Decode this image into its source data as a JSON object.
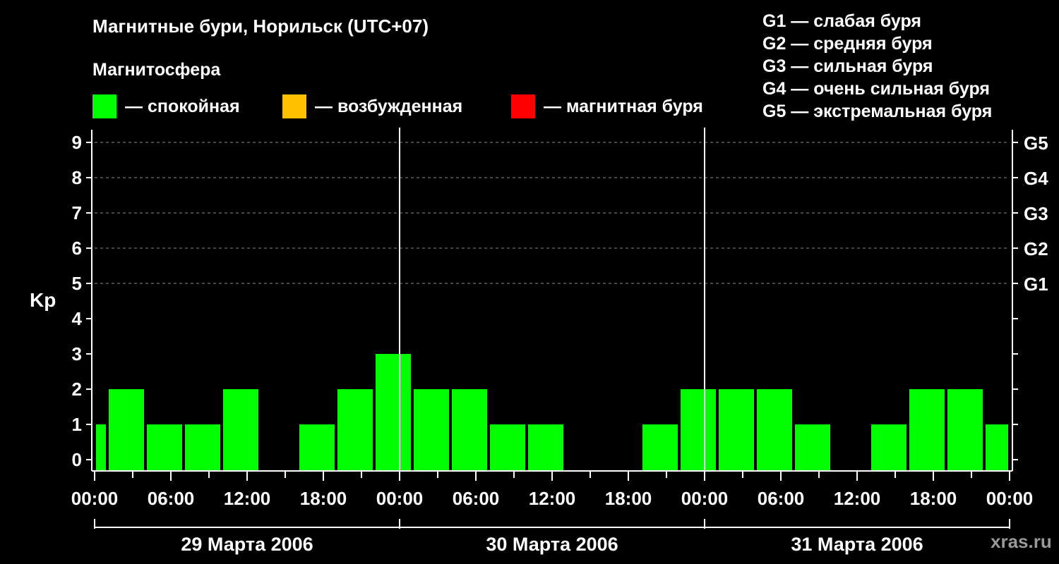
{
  "title": "Магнитные бури, Норильск (UTC+07)",
  "subtitle": "Магнитосфера",
  "legend": [
    {
      "color": "#00ff00",
      "label": "— спокойная"
    },
    {
      "color": "#ffc000",
      "label": "— возбужденная"
    },
    {
      "color": "#ff0000",
      "label": "— магнитная буря"
    }
  ],
  "g_legend": [
    "G1 — слабая буря",
    "G2 — средняя буря",
    "G3 — сильная буря",
    "G4 — очень сильная буря",
    "G5 — экстремальная буря"
  ],
  "watermark": "xras.ru",
  "chart_data": {
    "type": "bar",
    "ylabel": "Kp",
    "ylim": [
      0,
      9
    ],
    "yticks": [
      "0",
      "1",
      "2",
      "3",
      "4",
      "5",
      "6",
      "7",
      "8",
      "9"
    ],
    "right_ticks": [
      {
        "kp": 5,
        "label": "G1"
      },
      {
        "kp": 6,
        "label": "G2"
      },
      {
        "kp": 7,
        "label": "G3"
      },
      {
        "kp": 8,
        "label": "G4"
      },
      {
        "kp": 9,
        "label": "G5"
      }
    ],
    "grid_y": [
      5,
      6,
      7,
      8,
      9
    ],
    "xticks": [
      "00:00",
      "06:00",
      "12:00",
      "18:00",
      "00:00",
      "06:00",
      "12:00",
      "18:00",
      "00:00",
      "06:00",
      "12:00",
      "18:00",
      "00:00"
    ],
    "days": [
      "29 Марта 2006",
      "30 Марта 2006",
      "31 Марта 2006"
    ],
    "interval_hours": 3,
    "bars": [
      {
        "start_hour": 0,
        "end_hour": 1,
        "kp": 1,
        "color": "#00ff00"
      },
      {
        "start_hour": 1,
        "end_hour": 4,
        "kp": 2,
        "color": "#00ff00"
      },
      {
        "start_hour": 4,
        "end_hour": 7,
        "kp": 1,
        "color": "#00ff00"
      },
      {
        "start_hour": 7,
        "end_hour": 10,
        "kp": 1,
        "color": "#00ff00"
      },
      {
        "start_hour": 10,
        "end_hour": 13,
        "kp": 2,
        "color": "#00ff00"
      },
      {
        "start_hour": 13,
        "end_hour": 16,
        "kp": 0,
        "color": "#00ff00"
      },
      {
        "start_hour": 16,
        "end_hour": 19,
        "kp": 1,
        "color": "#00ff00"
      },
      {
        "start_hour": 19,
        "end_hour": 22,
        "kp": 2,
        "color": "#00ff00"
      },
      {
        "start_hour": 22,
        "end_hour": 25,
        "kp": 3,
        "color": "#00ff00"
      },
      {
        "start_hour": 25,
        "end_hour": 28,
        "kp": 2,
        "color": "#00ff00"
      },
      {
        "start_hour": 28,
        "end_hour": 31,
        "kp": 2,
        "color": "#00ff00"
      },
      {
        "start_hour": 31,
        "end_hour": 34,
        "kp": 1,
        "color": "#00ff00"
      },
      {
        "start_hour": 34,
        "end_hour": 37,
        "kp": 1,
        "color": "#00ff00"
      },
      {
        "start_hour": 37,
        "end_hour": 40,
        "kp": 0,
        "color": "#00ff00"
      },
      {
        "start_hour": 40,
        "end_hour": 43,
        "kp": 0,
        "color": "#00ff00"
      },
      {
        "start_hour": 43,
        "end_hour": 46,
        "kp": 1,
        "color": "#00ff00"
      },
      {
        "start_hour": 46,
        "end_hour": 49,
        "kp": 2,
        "color": "#00ff00"
      },
      {
        "start_hour": 49,
        "end_hour": 52,
        "kp": 2,
        "color": "#00ff00"
      },
      {
        "start_hour": 52,
        "end_hour": 55,
        "kp": 2,
        "color": "#00ff00"
      },
      {
        "start_hour": 55,
        "end_hour": 58,
        "kp": 1,
        "color": "#00ff00"
      },
      {
        "start_hour": 58,
        "end_hour": 61,
        "kp": 0,
        "color": "#00ff00"
      },
      {
        "start_hour": 61,
        "end_hour": 64,
        "kp": 1,
        "color": "#00ff00"
      },
      {
        "start_hour": 64,
        "end_hour": 67,
        "kp": 2,
        "color": "#00ff00"
      },
      {
        "start_hour": 67,
        "end_hour": 70,
        "kp": 2,
        "color": "#00ff00"
      },
      {
        "start_hour": 70,
        "end_hour": 72,
        "kp": 1,
        "color": "#00ff00"
      }
    ]
  }
}
